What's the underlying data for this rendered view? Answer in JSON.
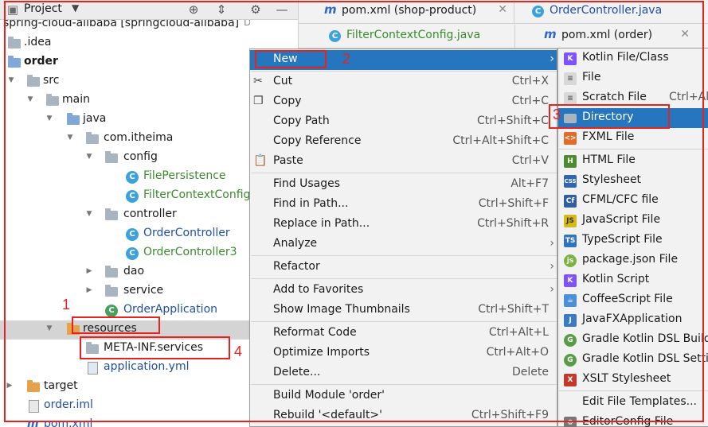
{
  "project_panel": {
    "title": "Project",
    "root_label": "spring-cloud-alibaba [springcloud-alibaba]",
    "root_path": "D:\\work-s",
    "tree": [
      {
        "label": "spring-cloud-alibaba [springcloud-alibaba]",
        "icon": "folder-icon"
      },
      {
        "label": ".idea",
        "icon": "folder-icon"
      },
      {
        "label": "order",
        "icon": "module-folder-icon"
      },
      {
        "label": "src",
        "icon": "folder-icon"
      },
      {
        "label": "main",
        "icon": "folder-icon"
      },
      {
        "label": "java",
        "icon": "source-folder-icon"
      },
      {
        "label": "com.itheima",
        "icon": "package-icon"
      },
      {
        "label": "config",
        "icon": "package-icon"
      },
      {
        "label": "FilePersistence",
        "icon": "class-icon"
      },
      {
        "label": "FilterContextConfig",
        "icon": "class-icon"
      },
      {
        "label": "controller",
        "icon": "package-icon"
      },
      {
        "label": "OrderController",
        "icon": "class-icon"
      },
      {
        "label": "OrderController3",
        "icon": "class-icon"
      },
      {
        "label": "dao",
        "icon": "package-icon"
      },
      {
        "label": "service",
        "icon": "package-icon"
      },
      {
        "label": "OrderApplication",
        "icon": "spring-class-icon"
      },
      {
        "label": "resources",
        "icon": "resources-folder-icon"
      },
      {
        "label": "META-INF.services",
        "icon": "folder-icon"
      },
      {
        "label": "application.yml",
        "icon": "yaml-file-icon"
      },
      {
        "label": "target",
        "icon": "excluded-folder-icon"
      },
      {
        "label": "order.iml",
        "icon": "iml-file-icon"
      },
      {
        "label": "pom.xml",
        "icon": "maven-file-icon"
      }
    ]
  },
  "editor_tabs": [
    {
      "label": "pom.xml (shop-product)",
      "icon": "maven-icon"
    },
    {
      "label": "OrderController.java",
      "icon": "class-icon"
    },
    {
      "label": "FilterContextConfig.java",
      "icon": "class-icon"
    },
    {
      "label": "pom.xml (order)",
      "icon": "maven-icon"
    }
  ],
  "context_menu": [
    {
      "label": "New",
      "shortcut": "",
      "submenu": true,
      "highlighted": true
    },
    {
      "label": "Cut",
      "shortcut": "Ctrl+X",
      "icon": "scissors-icon"
    },
    {
      "label": "Copy",
      "shortcut": "Ctrl+C",
      "icon": "copy-icon"
    },
    {
      "label": "Copy Path",
      "shortcut": "Ctrl+Shift+C"
    },
    {
      "label": "Copy Reference",
      "shortcut": "Ctrl+Alt+Shift+C"
    },
    {
      "label": "Paste",
      "shortcut": "Ctrl+V",
      "icon": "paste-icon"
    },
    {
      "label": "Find Usages",
      "shortcut": "Alt+F7"
    },
    {
      "label": "Find in Path...",
      "shortcut": "Ctrl+Shift+F"
    },
    {
      "label": "Replace in Path...",
      "shortcut": "Ctrl+Shift+R"
    },
    {
      "label": "Analyze",
      "shortcut": "",
      "submenu": true
    },
    {
      "label": "Refactor",
      "shortcut": "",
      "submenu": true
    },
    {
      "label": "Add to Favorites",
      "shortcut": "",
      "submenu": true
    },
    {
      "label": "Show Image Thumbnails",
      "shortcut": "Ctrl+Shift+T"
    },
    {
      "label": "Reformat Code",
      "shortcut": "Ctrl+Alt+L"
    },
    {
      "label": "Optimize Imports",
      "shortcut": "Ctrl+Alt+O"
    },
    {
      "label": "Delete...",
      "shortcut": "Delete"
    },
    {
      "label": "Build Module 'order'",
      "shortcut": ""
    },
    {
      "label": "Rebuild '<default>'",
      "shortcut": "Ctrl+Shift+F9"
    }
  ],
  "new_submenu": [
    {
      "label": "Kotlin File/Class",
      "icon": "kotlin-icon",
      "color": "#7f52ff"
    },
    {
      "label": "File",
      "icon": "file-icon",
      "color": "#9a9a9a"
    },
    {
      "label": "Scratch File",
      "shortcut": "Ctrl+Alt+Shift+Insert",
      "icon": "scratch-icon",
      "color": "#8a8a8a"
    },
    {
      "label": "Directory",
      "icon": "folder-icon",
      "color": "#a8b4c0",
      "highlighted": true
    },
    {
      "label": "FXML File",
      "icon": "fxml-icon",
      "color": "#e06b2b"
    },
    {
      "label": "HTML File",
      "icon": "html-icon",
      "color": "#4f8a33"
    },
    {
      "label": "Stylesheet",
      "icon": "css-icon",
      "color": "#3066b0"
    },
    {
      "label": "CFML/CFC file",
      "icon": "cfml-icon",
      "color": "#2f5ea3"
    },
    {
      "label": "JavaScript File",
      "icon": "js-icon",
      "color": "#d6b91a"
    },
    {
      "label": "TypeScript File",
      "icon": "ts-icon",
      "color": "#2f74c0"
    },
    {
      "label": "package.json File",
      "icon": "nodejs-icon",
      "color": "#7ab341"
    },
    {
      "label": "Kotlin Script",
      "icon": "kotlin-script-icon",
      "color": "#7f52ff"
    },
    {
      "label": "CoffeeScript File",
      "icon": "coffeescript-icon",
      "color": "#4b8fd6"
    },
    {
      "label": "JavaFXApplication",
      "icon": "javafx-icon",
      "color": "#3b78c6"
    },
    {
      "label": "Gradle Kotlin DSL Build Script",
      "icon": "gradle-icon",
      "color": "#5a9b4a"
    },
    {
      "label": "Gradle Kotlin DSL Settings",
      "icon": "gradle-icon",
      "color": "#5a9b4a"
    },
    {
      "label": "XSLT Stylesheet",
      "icon": "xslt-icon",
      "color": "#c0392b"
    },
    {
      "label": "Edit File Templates...",
      "icon": ""
    },
    {
      "label": "EditorConfig File",
      "icon": "editorconfig-icon",
      "color": "#777777"
    }
  ],
  "annotations": [
    "1",
    "2",
    "3",
    "4"
  ],
  "colors": {
    "highlight": "#2675bf",
    "annotation": "#e8231e"
  }
}
